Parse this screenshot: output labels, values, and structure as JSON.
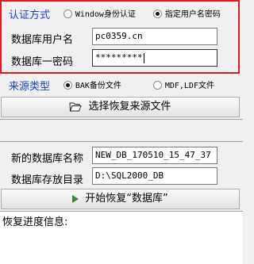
{
  "auth": {
    "label": "认证方式",
    "options": [
      "Window身份认证",
      "指定用户名密码"
    ],
    "selected_index": 1
  },
  "username": {
    "label": "数据库用户名",
    "value": "pc0359.cn"
  },
  "password": {
    "label": "数据库一密码",
    "value": "*********"
  },
  "source": {
    "label": "来源类型",
    "options": [
      "BAK备份文件",
      "MDF,LDF文件"
    ],
    "selected_index": 0
  },
  "choose_button": {
    "label": "选择恢复来源文件",
    "icon": "folder-open-icon"
  },
  "new_db": {
    "label": "新的数据库名称",
    "value": "NEW_DB_170510_15_47_37"
  },
  "db_dir": {
    "label": "数据库存放目录",
    "value": "D:\\SQL2000_DB"
  },
  "start_button": {
    "label": "开始恢复“数据库”",
    "icon": "play-icon"
  },
  "progress": {
    "label": "恢复进度信息:"
  },
  "colors": {
    "accent_blue": "#1a3fd1",
    "highlight_red": "#e0191e",
    "play_green": "#2c8a2c"
  }
}
